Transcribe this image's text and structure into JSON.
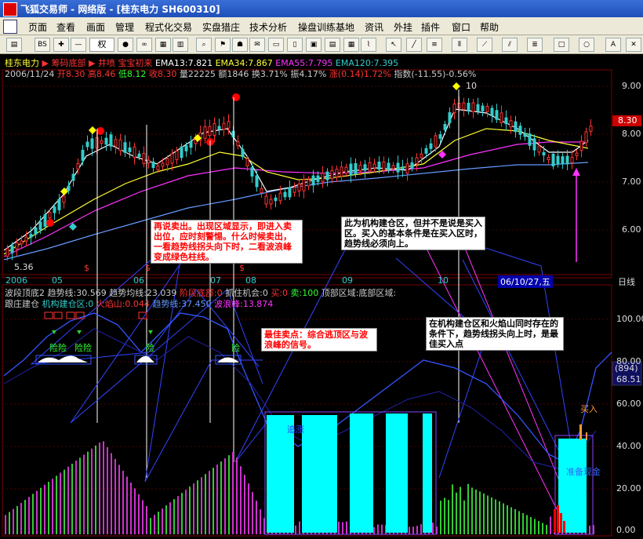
{
  "window": {
    "title": "飞狐交易师 - 网络版 - [桂东电力 SH600310]"
  },
  "menu": [
    "页面",
    "查看",
    "画面",
    "管理",
    "程式化交易",
    "实盘猎庄",
    "技术分析",
    "操盘训练基地",
    "资讯",
    "外挂",
    "插件",
    "窗口",
    "帮助"
  ],
  "toolbar": {
    "period_select": "权"
  },
  "info": {
    "stock_name": "桂东电力",
    "tags": [
      "筹码底部",
      "井喷",
      "宝宝初来"
    ],
    "ema": [
      {
        "label": "EMA13:7.821",
        "color": "#ffffff"
      },
      {
        "label": "EMA34:7.867",
        "color": "#ffff33"
      },
      {
        "label": "EMA55:7.795",
        "color": "#ff33ff"
      },
      {
        "label": "EMA120:7.395",
        "color": "#33cccc"
      }
    ],
    "quote": [
      {
        "label": "2006/11/24",
        "color": "#cccccc"
      },
      {
        "label": "开8.30",
        "color": "#ff3333"
      },
      {
        "label": "高8.46",
        "color": "#ff3333"
      },
      {
        "label": "低8.12",
        "color": "#33ff33"
      },
      {
        "label": "收8.30",
        "color": "#ff3333"
      },
      {
        "label": "量22225",
        "color": "#cccccc"
      },
      {
        "label": "额1846",
        "color": "#cccccc"
      },
      {
        "label": "换3.71%",
        "color": "#cccccc"
      },
      {
        "label": "振4.17%",
        "color": "#cccccc"
      },
      {
        "label": "涨(0.14)1.72%",
        "color": "#ff3333"
      },
      {
        "label": "指数(-11.55)-0.56%",
        "color": "#cccccc"
      }
    ]
  },
  "main_chart": {
    "y_labels": [
      "9.00",
      "8.00",
      "7.00",
      "6.00"
    ],
    "current_price": "8.30",
    "low_label": "5.36",
    "high_label": "10",
    "dates": [
      "2006",
      "05",
      "06",
      "07",
      "08",
      "09",
      "10"
    ],
    "tooltip_date": "06/10/27,五",
    "period_label": "日线",
    "s_marks": [
      "$",
      "$",
      "$"
    ]
  },
  "indicator": {
    "line1": [
      {
        "label": "波段顶底2",
        "color": "#cccccc"
      },
      {
        "label": "趋势线:30.569",
        "color": "#cccccc"
      },
      {
        "label": "趋势均线:23.039",
        "color": "#cccccc"
      },
      {
        "label": "阶段底部:0",
        "color": "#ff3333"
      },
      {
        "label": "抓住机会:0",
        "color": "#cccccc"
      },
      {
        "label": "买:0",
        "color": "#ff3333"
      },
      {
        "label": "卖:100",
        "color": "#33ff33"
      },
      {
        "label": "顶部区域:底部区域:",
        "color": "#cccccc"
      }
    ],
    "line2": [
      {
        "label": "跟庄建仓",
        "color": "#cccccc"
      },
      {
        "label": "机构建仓区:0",
        "color": "#33cccc"
      },
      {
        "label": "火焰山:0.044",
        "color": "#ff3333"
      },
      {
        "label": "趋势线:37.450",
        "color": "#6699ff"
      },
      {
        "label": "波浪峰:13.874",
        "color": "#ff33ff"
      }
    ],
    "y_labels": [
      "100.00",
      "80.00",
      "60.00",
      "40.00",
      "20.00",
      "0.00"
    ],
    "box_value1": "(894)",
    "box_value2": "68.51",
    "risk_labels": [
      "险险",
      "险险",
      "险",
      "险"
    ],
    "chase_label": "追涨",
    "prepare_label": "准备现金",
    "buy_label": "买入"
  },
  "annotations": {
    "note1": "再说卖出。出现区域显示，即进入卖出位，应时刻警惕。什么时候卖出，一看趋势线拐头向下时，二看波浪峰变成绿色柱线。",
    "note2": "此为机构建仓区，但并不是说是买入区。买入的基本条件是在买入区时，趋势线必须向上。",
    "note3": "最佳卖点：综合逃顶区与波浪峰的信号。",
    "note4": "在机构建仓区和火焰山同时存在的条件下，趋势线拐头向上时，是最佳买入点"
  }
}
